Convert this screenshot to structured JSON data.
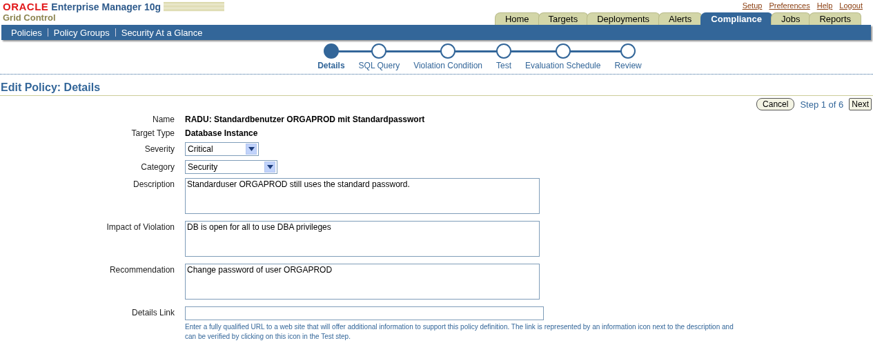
{
  "header": {
    "brand": "ORACLE",
    "product": "Enterprise Manager 10g",
    "subtitle": "Grid Control"
  },
  "global_links": [
    "Setup",
    "Preferences",
    "Help",
    "Logout"
  ],
  "tabs": [
    {
      "label": "Home",
      "selected": false
    },
    {
      "label": "Targets",
      "selected": false
    },
    {
      "label": "Deployments",
      "selected": false
    },
    {
      "label": "Alerts",
      "selected": false
    },
    {
      "label": "Compliance",
      "selected": true
    },
    {
      "label": "Jobs",
      "selected": false
    },
    {
      "label": "Reports",
      "selected": false
    }
  ],
  "subnav": [
    "Policies",
    "Policy Groups",
    "Security At a Glance"
  ],
  "train": [
    {
      "label": "Details",
      "selected": true
    },
    {
      "label": "SQL Query",
      "selected": false
    },
    {
      "label": "Violation Condition",
      "selected": false
    },
    {
      "label": "Test",
      "selected": false
    },
    {
      "label": "Evaluation Schedule",
      "selected": false
    },
    {
      "label": "Review",
      "selected": false
    }
  ],
  "page_title": "Edit Policy: Details",
  "actions": {
    "cancel": "Cancel",
    "step": "Step 1 of 6",
    "next": "Next"
  },
  "form": [
    {
      "kind": "text",
      "label": "Name",
      "value": "RADU: Standardbenutzer ORGAPROD mit Standardpasswort"
    },
    {
      "kind": "text",
      "label": "Target Type",
      "value": "Database Instance"
    },
    {
      "kind": "select",
      "label": "Severity",
      "value": "Critical"
    },
    {
      "kind": "select",
      "label": "Category",
      "value": "Security"
    },
    {
      "kind": "textarea",
      "label": "Description",
      "value": "Standarduser ORGAPROD still uses the standard password."
    },
    {
      "kind": "textarea",
      "label": "Impact of Violation",
      "value": "DB is open for all to use DBA privileges"
    },
    {
      "kind": "textarea",
      "label": "Recommendation",
      "value": "Change password of user ORGAPROD"
    },
    {
      "kind": "input",
      "label": "Details Link",
      "hint": "Enter a fully qualified URL to a web site that will offer additional information to support this policy definition. The link is represented by an information icon next to the description and can be verified by clicking on this icon in the Test step."
    }
  ]
}
